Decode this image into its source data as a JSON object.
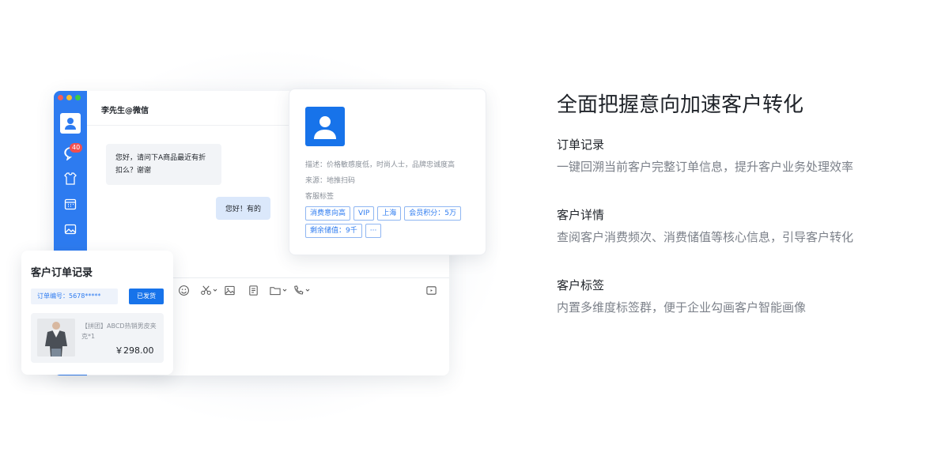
{
  "chat": {
    "title": "李先生@微信",
    "unread_count": "40",
    "message_in": "您好，请问下A商品最近有折扣么？谢谢",
    "message_out": "您好！有的"
  },
  "customer": {
    "desc_line": "描述：价格敏感度低，时尚人士，品牌忠诚度高",
    "source_line": "来源：地推扫码",
    "tags_label": "客服标签",
    "tags": [
      "消费意向高",
      "VIP",
      "上海",
      "会员积分：5万",
      "剩余储值：9千",
      "···"
    ]
  },
  "order": {
    "title": "客户订单记录",
    "order_no": "订单编号：5678*****",
    "status_button": "已发货",
    "product_name": "【拼团】ABCD热销男皮夹克*1",
    "price": "￥298.00"
  },
  "info_panel": {
    "headline": "全面把握意向加速客户转化",
    "features": [
      {
        "title": "订单记录",
        "desc": "一键回溯当前客户完整订单信息，提升客户业务处理效率"
      },
      {
        "title": "客户详情",
        "desc": "查阅客户消费频次、消费储值等核心信息，引导客户转化"
      },
      {
        "title": "客户标签",
        "desc": "内置多维度标签群，便于企业勾画客户智能画像"
      }
    ]
  },
  "colors": {
    "brand_blue": "#1773ea",
    "sidebar_blue": "#2d7bf0",
    "badge_red": "#f24e4e"
  }
}
